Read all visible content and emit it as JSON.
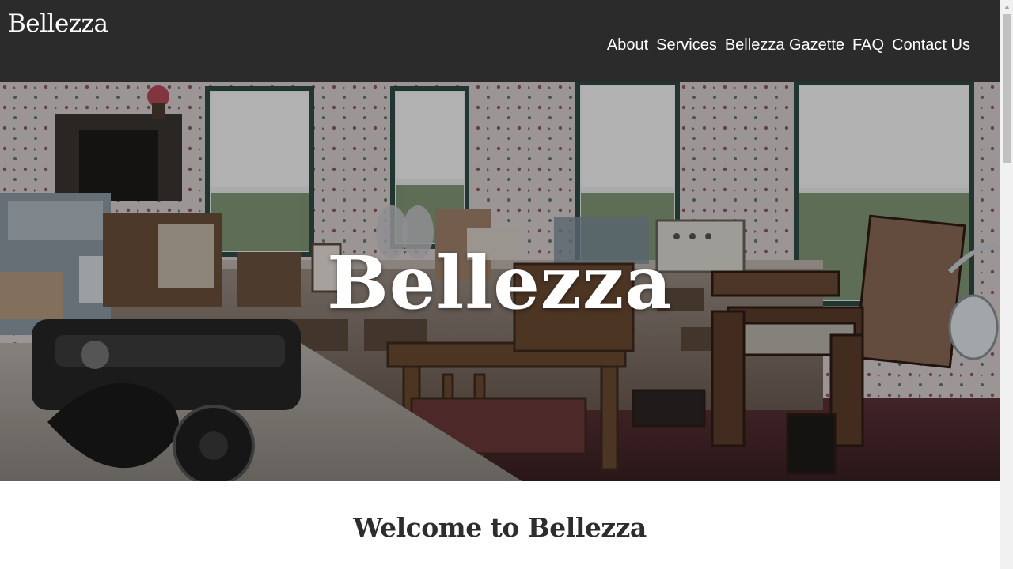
{
  "header": {
    "brand": "Bellezza",
    "nav": [
      {
        "label": "About"
      },
      {
        "label": "Services"
      },
      {
        "label": "Bellezza Gazette"
      },
      {
        "label": "FAQ"
      },
      {
        "label": "Contact Us"
      }
    ]
  },
  "hero": {
    "title": "Bellezza"
  },
  "welcome": {
    "heading": "Welcome to Bellezza"
  },
  "colors": {
    "header_bg": "#2b2b2b",
    "text_light": "#ffffff",
    "text_dark": "#2d2d2d"
  },
  "icons": {
    "scroll_up": "triangle-up"
  }
}
